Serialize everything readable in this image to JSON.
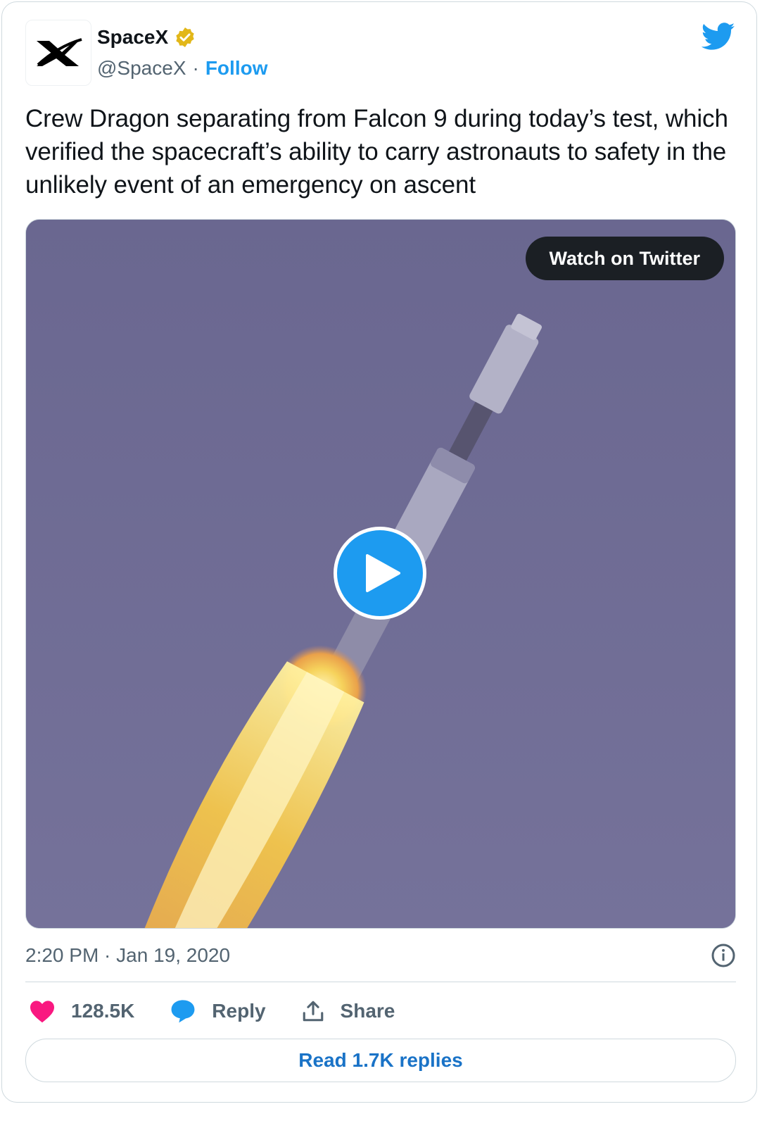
{
  "author": {
    "name": "SpaceX",
    "handle": "@SpaceX",
    "separator": "·",
    "follow_label": "Follow",
    "verified_badge_color": "#e2b719",
    "avatar_icon": "spacex-logo-icon"
  },
  "brand": {
    "icon": "twitter-bird-icon",
    "color": "#1d9bf0"
  },
  "tweet": {
    "text": "Crew Dragon separating from Falcon 9 during today’s test, which verified the spacecraft’s ability to carry astronauts to safety in the unlikely event of an emergency on ascent"
  },
  "media": {
    "watch_label": "Watch on Twitter",
    "play_icon": "play-icon"
  },
  "meta": {
    "timestamp": "2:20 PM · Jan 19, 2020",
    "info_icon": "info-icon"
  },
  "actions": {
    "like_count": "128.5K",
    "like_color": "#f91880",
    "reply_label": "Reply",
    "share_label": "Share"
  },
  "footer": {
    "read_replies_label": "Read 1.7K replies"
  }
}
